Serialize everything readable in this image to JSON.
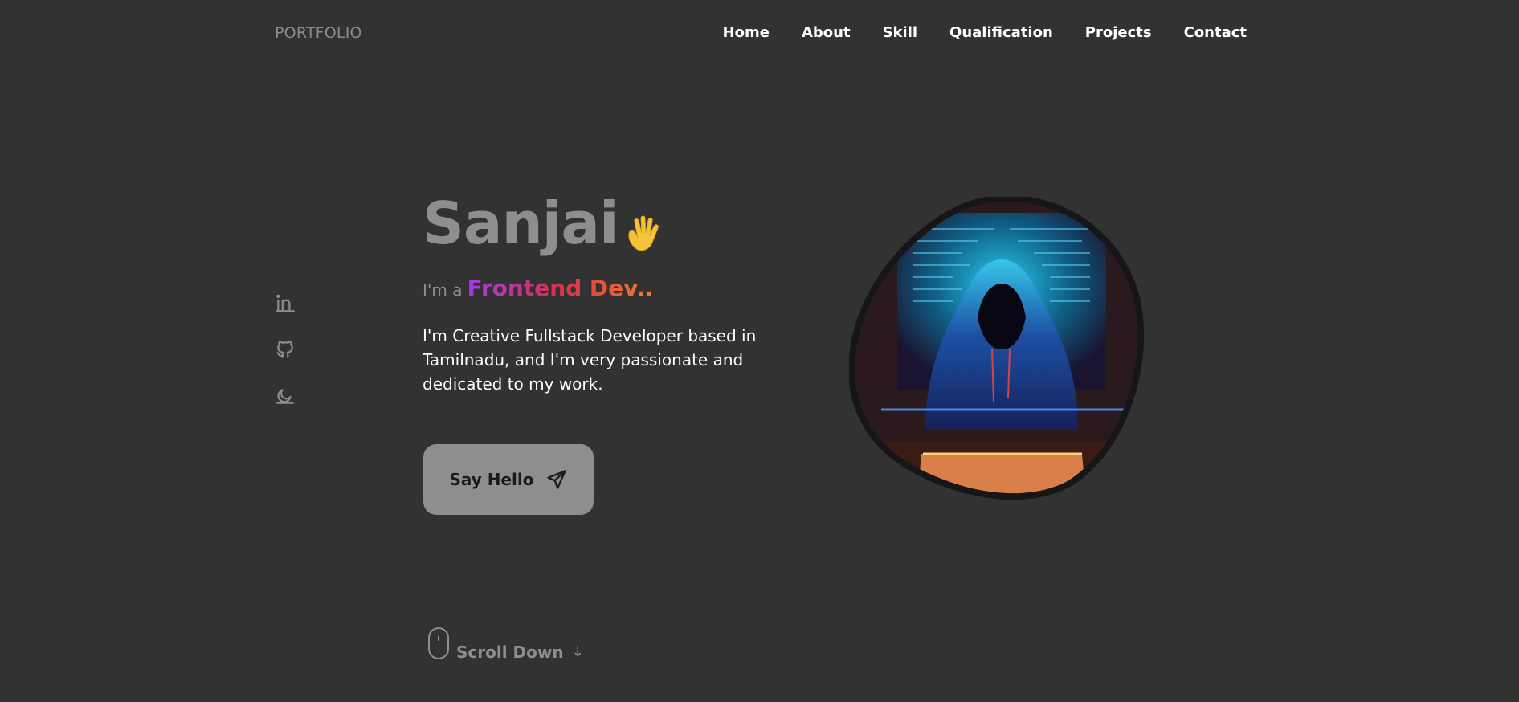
{
  "brand": "PORTFOLIO",
  "nav": {
    "items": [
      "Home",
      "About",
      "Skill",
      "Qualification",
      "Projects",
      "Contact"
    ]
  },
  "social": {
    "icons": [
      "linkedin-icon",
      "github-icon",
      "moon-icon"
    ]
  },
  "hero": {
    "name": "Sanjai",
    "wave_emoji": "waving-hand-icon",
    "subtitle_prefix": "I'm a",
    "subtitle_role": "Frontend Dev..",
    "description": "I'm Creative Fullstack Developer based in Tamilnadu, and I'm very passionate and dedicated to my work.",
    "cta_label": "Say Hello",
    "scroll_label": "Scroll Down"
  },
  "colors": {
    "background": "#323232",
    "muted": "#8e8e8e",
    "text": "#ffffff",
    "gradient": [
      "#a13be0",
      "#d8324d",
      "#f57a2c"
    ]
  }
}
